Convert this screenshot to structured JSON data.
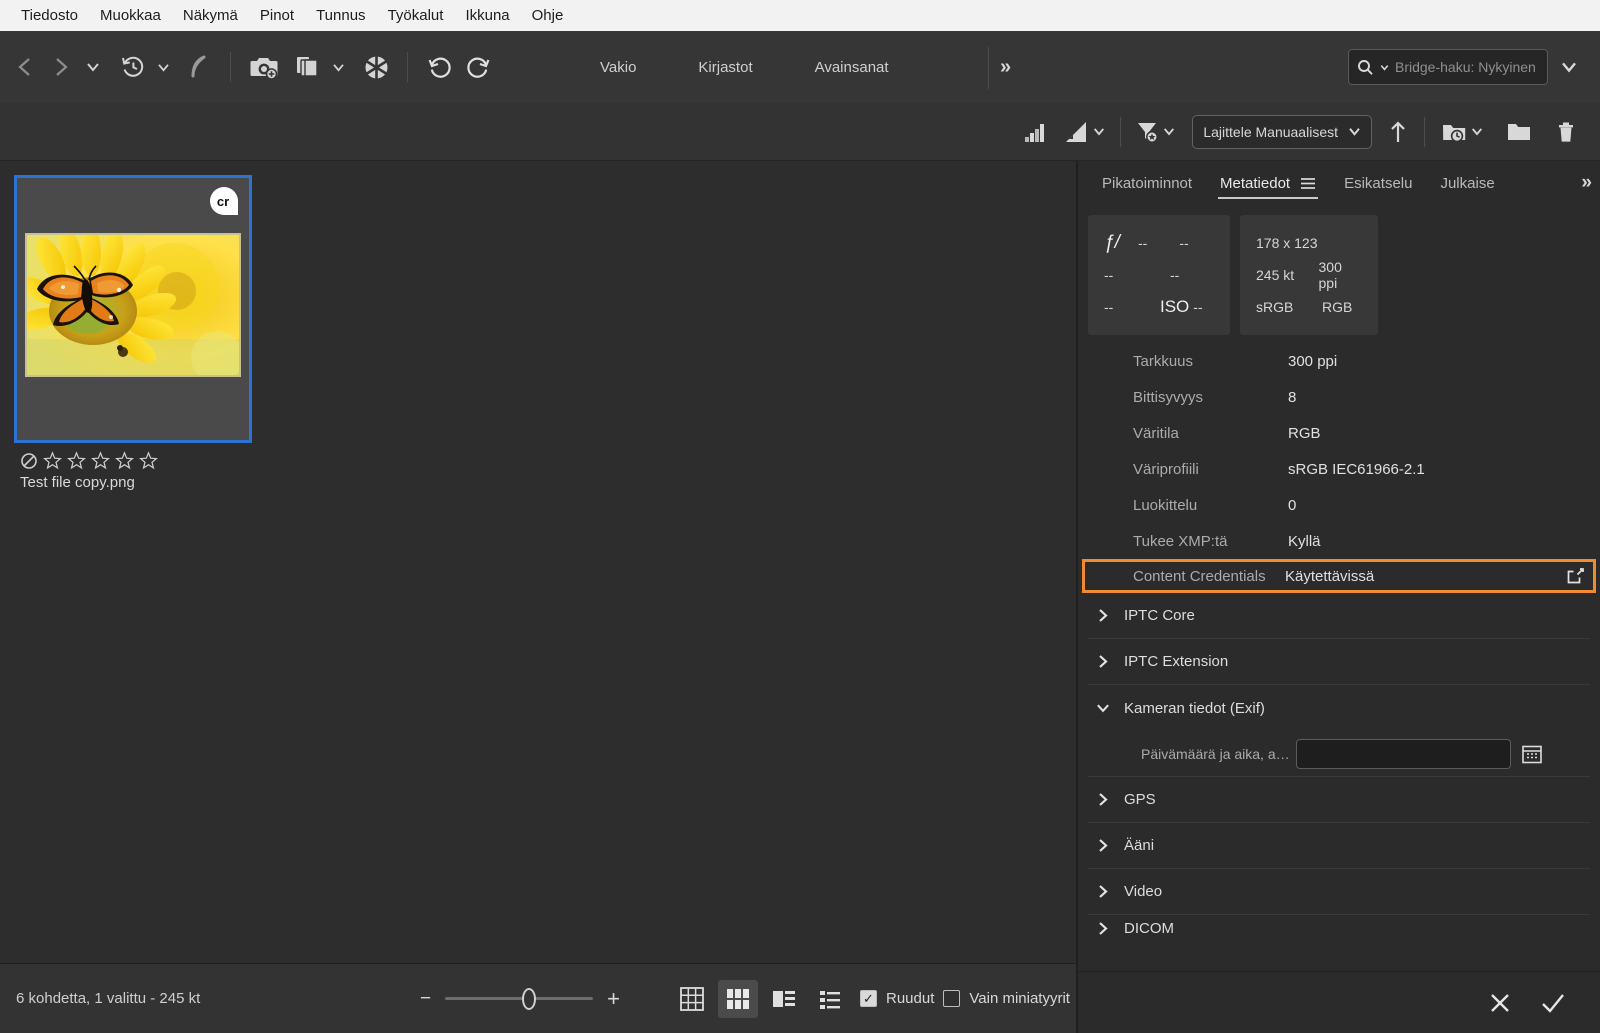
{
  "menubar": {
    "items": [
      {
        "label": "Tiedosto"
      },
      {
        "label": "Muokkaa"
      },
      {
        "label": "Näkymä"
      },
      {
        "label": "Pinot"
      },
      {
        "label": "Tunnus"
      },
      {
        "label": "Työkalut"
      },
      {
        "label": "Ikkuna"
      },
      {
        "label": "Ohje"
      }
    ]
  },
  "toolbar": {
    "icons": [
      {
        "name": "back-arrow-icon"
      },
      {
        "name": "forward-arrow-icon"
      },
      {
        "name": "chevron-down-icon"
      },
      {
        "name": "history-clock-icon"
      },
      {
        "name": "chevron-down-icon"
      },
      {
        "name": "boomerang-icon"
      },
      {
        "name": "camera-add-icon"
      },
      {
        "name": "duplicate-files-icon"
      },
      {
        "name": "chevron-down-icon"
      },
      {
        "name": "aperture-refresh-icon"
      },
      {
        "name": "rotate-counterclockwise-icon"
      },
      {
        "name": "rotate-clockwise-icon"
      }
    ],
    "workspaces": [
      {
        "label": "Vakio"
      },
      {
        "label": "Kirjastot"
      },
      {
        "label": "Avainsanat"
      }
    ],
    "overflow_label": "»",
    "search": {
      "placeholder": "Bridge-haku: Nykyinen",
      "value": "",
      "icon": "search-icon"
    }
  },
  "toolbar2": {
    "items": [
      {
        "name": "rating-filter-icon",
        "label": ""
      },
      {
        "name": "rating-filter-dropdown-icon",
        "label": ""
      },
      {
        "name": "filter-funnel-icon",
        "label": ""
      }
    ],
    "sort": {
      "label": "Lajittele Manuaalisest",
      "icon": "chevron-down-icon"
    },
    "ascending_icon": "arrow-up-icon",
    "recent_folder_icon": "folder-clock-icon",
    "new_folder_icon": "new-folder-icon",
    "delete_icon": "trash-icon"
  },
  "content": {
    "thumbnail": {
      "filename": "Test file copy.png",
      "badge": "cr",
      "badge_title": "Content Credentials",
      "rating": 0,
      "reject_icon": "reject-icon",
      "stars": 5,
      "selected": true,
      "alt": "Monarch butterfly on a yellow sunflower"
    }
  },
  "statusbar": {
    "status": "6 kohdetta, 1 valittu - 245 kt",
    "zoom": {
      "minus": "−",
      "plus": "+",
      "value": 57
    },
    "view_modes": [
      {
        "name": "view-grid-icon",
        "active": false
      },
      {
        "name": "view-thumbnails-icon",
        "active": true
      },
      {
        "name": "view-details-icon",
        "active": false
      },
      {
        "name": "view-list-icon",
        "active": false
      }
    ],
    "checkboxes": [
      {
        "label": "Ruudut",
        "checked": true
      },
      {
        "label": "Vain miniatyyrit",
        "checked": false
      }
    ]
  },
  "panel": {
    "tabs": [
      {
        "label": "Pikatoiminnot",
        "active": false
      },
      {
        "label": "Metatiedot",
        "active": true,
        "menu_icon": "hamburger-menu-icon"
      },
      {
        "label": "Esikatselu",
        "active": false
      },
      {
        "label": "Julkaise",
        "active": false
      }
    ],
    "overflow_label": "»",
    "placard_camera": {
      "aperture_symbol": "ƒ/",
      "aperture": "--",
      "shutter": "--",
      "r2c1": "--",
      "r2c2": "--",
      "r3c1": "--",
      "iso_symbol": "ISO",
      "iso": "--"
    },
    "placard_file": {
      "dimensions": "178 x 123",
      "filesize": "245 kt",
      "resolution": "300 ppi",
      "colorspace": "sRGB",
      "colormode": "RGB"
    },
    "metadata_rows": [
      {
        "label": "Tarkkuus",
        "value": "300 ppi",
        "highlight": false
      },
      {
        "label": "Bittisyvyys",
        "value": "8",
        "highlight": false
      },
      {
        "label": "Väritila",
        "value": "RGB",
        "highlight": false
      },
      {
        "label": "Väriprofiili",
        "value": "sRGB IEC61966-2.1",
        "highlight": false
      },
      {
        "label": "Luokittelu",
        "value": "0",
        "highlight": false
      },
      {
        "label": "Tukee XMP:tä",
        "value": "Kyllä",
        "highlight": false
      },
      {
        "label": "Content Credentials",
        "value": "Käytettävissä",
        "highlight": true
      }
    ],
    "highlight_color": "#f28b30",
    "sections": [
      {
        "label": "IPTC Core",
        "expanded": false
      },
      {
        "label": "IPTC Extension",
        "expanded": false
      },
      {
        "label": "Kameran tiedot (Exif)",
        "expanded": true
      },
      {
        "label": "GPS",
        "expanded": false
      },
      {
        "label": "Ääni",
        "expanded": false
      },
      {
        "label": "Video",
        "expanded": false
      },
      {
        "label": "DICOM",
        "expanded": false
      }
    ],
    "exif_field": {
      "label": "Päivämäärä ja aika, a…",
      "value": "",
      "calendar_icon": "calendar-icon"
    },
    "footer": {
      "cancel_icon": "close-icon",
      "apply_icon": "check-icon"
    }
  }
}
